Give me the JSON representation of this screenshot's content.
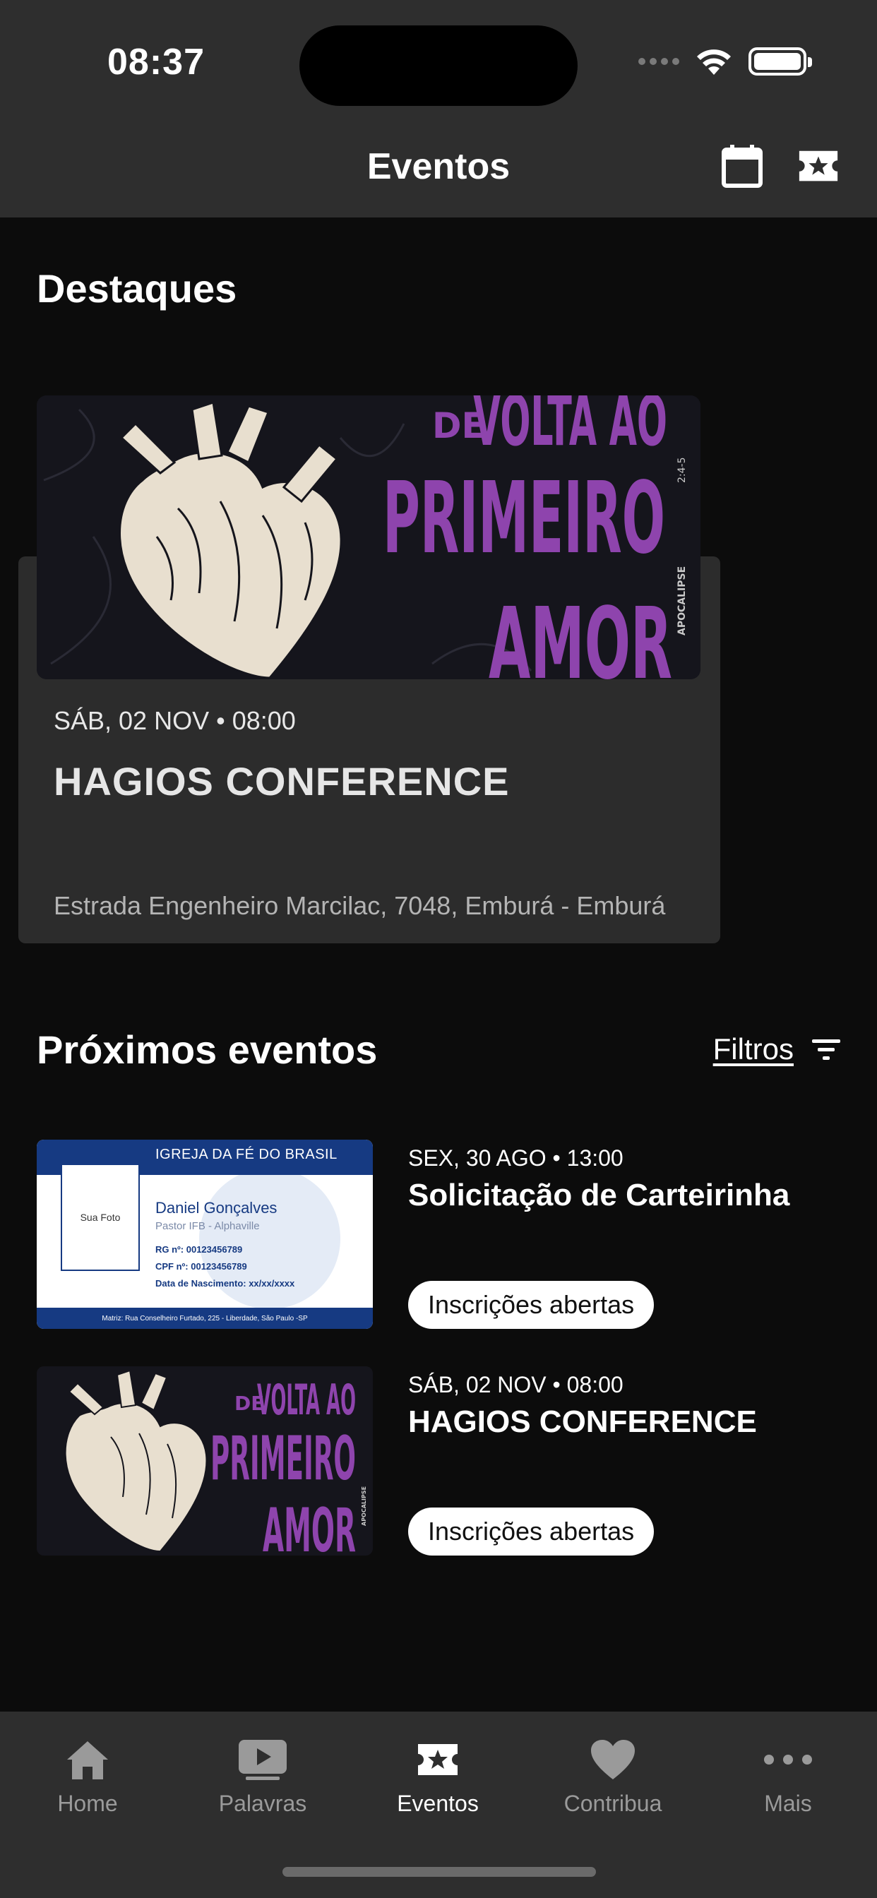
{
  "status_bar": {
    "time": "08:37"
  },
  "header": {
    "title": "Eventos",
    "calendar_icon": "calendar-icon",
    "ticket_icon": "ticket-star-icon"
  },
  "highlights": {
    "title": "Destaques",
    "card": {
      "poster": {
        "line1": "DE",
        "line2": "VOLTA AO",
        "line3": "PRIMEIRO",
        "line4": "AMOR",
        "side": "APOCALIPSE",
        "ref": "2:4-5"
      },
      "date": "SÁB, 02 NOV • 08:00",
      "title": "HAGIOS CONFERENCE",
      "address": "Estrada Engenheiro Marcilac, 7048,  Emburá - Emburá"
    }
  },
  "upcoming": {
    "title": "Próximos eventos",
    "filters_label": "Filtros",
    "events": [
      {
        "date": "SEX, 30 AGO • 13:00",
        "title": "Solicitação de Carteirinha",
        "badge": "Inscrições abertas",
        "card": {
          "org": "IGREJA DA FÉ DO BRASIL",
          "photo": "Sua Foto",
          "name": "Daniel Gonçalves",
          "role": "Pastor IFB - Alphaville",
          "rg": "RG nº: 00123456789",
          "cpf": "CPF nº: 00123456789",
          "birth": "Data de Nascimento: xx/xx/xxxx",
          "footer": "Matriz: Rua Conselheiro Furtado, 225 - Liberdade, São Paulo -SP"
        }
      },
      {
        "date": "SÁB, 02 NOV • 08:00",
        "title": "HAGIOS CONFERENCE",
        "badge": "Inscrições abertas",
        "poster": {
          "line1": "DE",
          "line2": "VOLTA AO",
          "line3": "PRIMEIRO",
          "line4": "AMOR",
          "side": "APOCALIPSE"
        }
      }
    ]
  },
  "tabbar": {
    "items": [
      {
        "label": "Home",
        "icon": "home-icon"
      },
      {
        "label": "Palavras",
        "icon": "play-icon"
      },
      {
        "label": "Eventos",
        "icon": "ticket-star-icon",
        "active": true
      },
      {
        "label": "Contribua",
        "icon": "heart-icon"
      },
      {
        "label": "Mais",
        "icon": "more-icon"
      }
    ]
  },
  "colors": {
    "poster_purple": "#8e44ad",
    "header_bg": "#2e2e2e",
    "page_bg": "#0c0c0c",
    "card_bg": "#2c2c2c"
  }
}
